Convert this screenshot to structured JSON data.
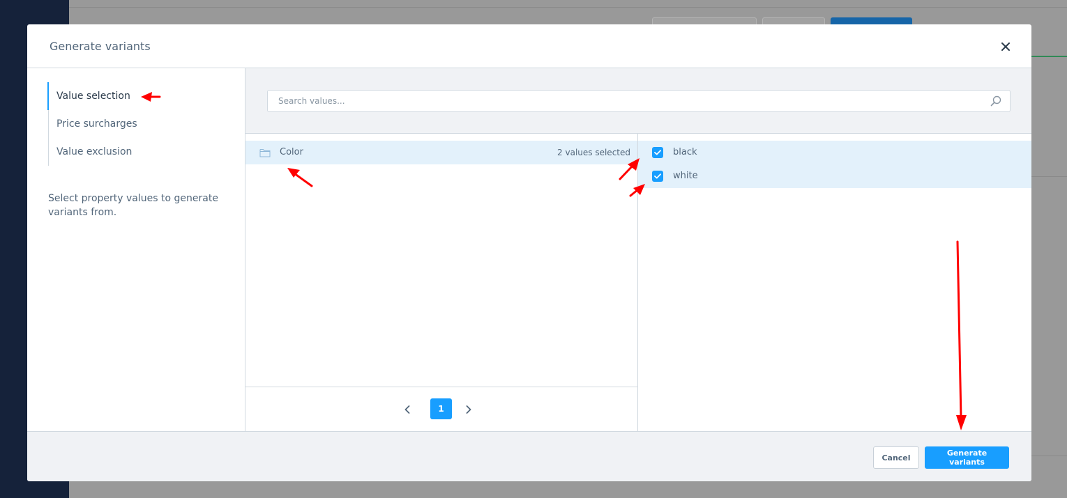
{
  "modal": {
    "title": "Generate variants",
    "close_icon": "close-icon"
  },
  "sidebar": {
    "items": [
      {
        "label": "Value selection",
        "active": true
      },
      {
        "label": "Price surcharges",
        "active": false
      },
      {
        "label": "Value exclusion",
        "active": false
      }
    ],
    "description": "Select property values to generate variants from."
  },
  "search": {
    "placeholder": "Search values...",
    "value": "",
    "icon": "search-icon"
  },
  "groups": [
    {
      "label": "Color",
      "count_text": "2 values selected",
      "icon": "folder-icon"
    }
  ],
  "values": [
    {
      "label": "black",
      "checked": true
    },
    {
      "label": "white",
      "checked": true
    }
  ],
  "pagination": {
    "current_page": "1",
    "prev_icon": "chevron-left-icon",
    "next_icon": "chevron-right-icon"
  },
  "footer": {
    "cancel_label": "Cancel",
    "submit_label": "Generate variants"
  },
  "colors": {
    "accent": "#189eff",
    "annotation": "#ff0000",
    "selected_row": "#e3f1fb",
    "app_sidebar": "#15223a"
  }
}
